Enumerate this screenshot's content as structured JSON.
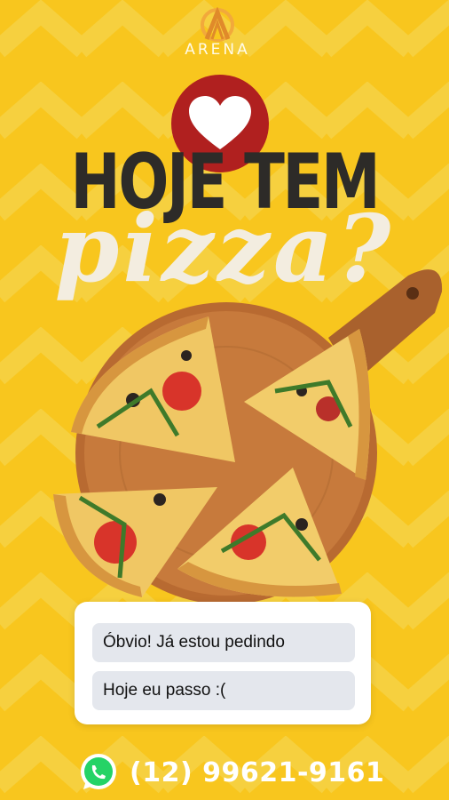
{
  "brand": {
    "logo_text": "ARENA"
  },
  "headline": {
    "line1": "HOJE TEM",
    "line2": "pizza?"
  },
  "poll": {
    "options": [
      {
        "label": "Óbvio! Já estou pedindo"
      },
      {
        "label": "Hoje eu passo :("
      }
    ]
  },
  "contact": {
    "phone": "(12) 99621-9161",
    "icon": "whatsapp-icon"
  },
  "colors": {
    "background": "#f8c61e",
    "chevron": "#f5d34a",
    "heart_badge": "#b0201f",
    "title": "#2d2b28",
    "script": "#f3ede0",
    "option_bg": "#e4e7ed",
    "whatsapp": "#25d366"
  },
  "icons": [
    "logo-mark-icon",
    "heart-icon",
    "whatsapp-icon"
  ]
}
